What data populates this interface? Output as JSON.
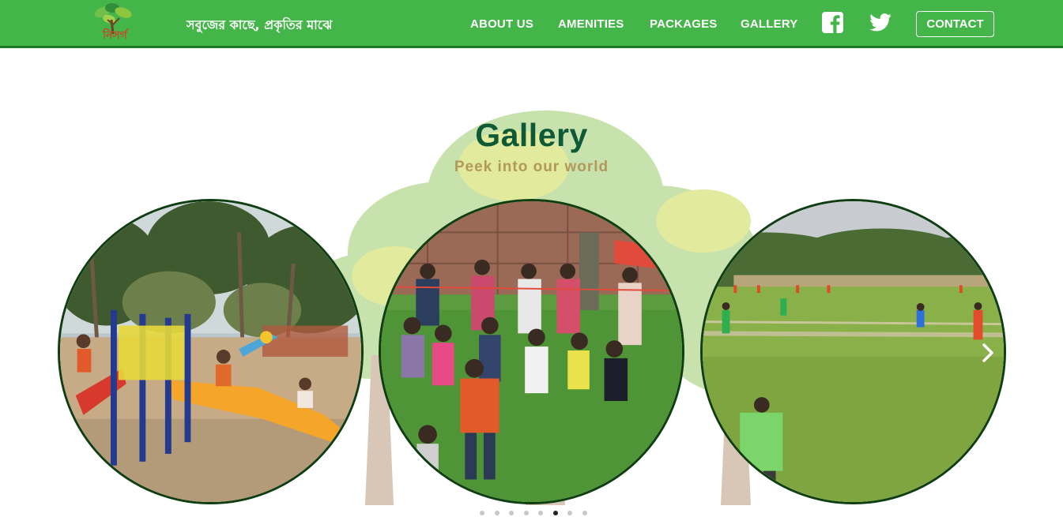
{
  "header": {
    "logo_icon": "tree-logo-icon",
    "logo_text": "নিসর্গ",
    "tagline": "সবুজের কাছে, প্রকৃতির মাঝে",
    "nav": [
      {
        "label": "ABOUT US"
      },
      {
        "label": "AMENITIES"
      },
      {
        "label": "PACKAGES"
      },
      {
        "label": "GALLERY"
      }
    ],
    "social": [
      {
        "icon": "facebook-icon"
      },
      {
        "icon": "twitter-icon"
      }
    ],
    "contact_label": "CONTACT",
    "bar_color": "#44b549"
  },
  "gallery": {
    "title": "Gallery",
    "subtitle": "Peek into our world",
    "title_color": "#0f5a36",
    "subtitle_color": "#b1995a",
    "photos": [
      {
        "subject": "children on playground slide"
      },
      {
        "subject": "children running race on lawn"
      },
      {
        "subject": "cricket match on green field"
      }
    ],
    "next_icon": "chevron-right-icon",
    "slide_count": 8,
    "active_slide": 6
  }
}
